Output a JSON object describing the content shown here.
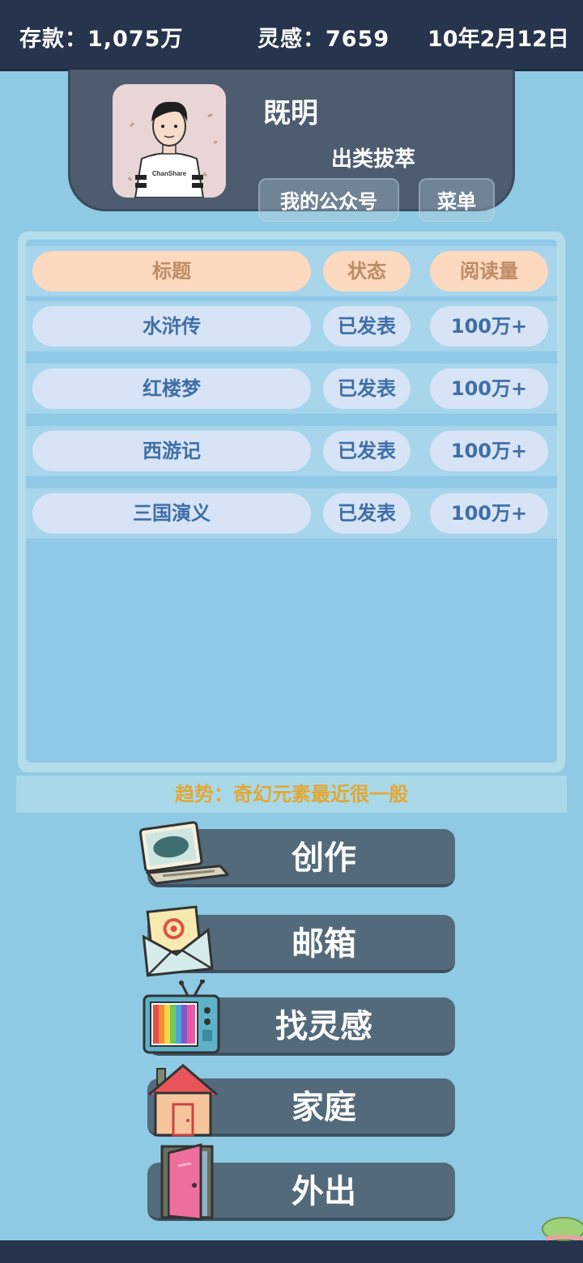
{
  "status_bar": {
    "money": "存款：1,075万",
    "inspiration": "灵感：7659",
    "date": "10年2月12日"
  },
  "profile": {
    "name": "既明",
    "title": "出类拔萃",
    "avatar_shirt_text": "ChanShare",
    "buttons": {
      "official_account": "我的公众号",
      "menu": "菜单"
    }
  },
  "table": {
    "headers": {
      "title": "标题",
      "status": "状态",
      "reads": "阅读量"
    },
    "rows": [
      {
        "title": "水浒传",
        "status": "已发表",
        "reads": "100万+"
      },
      {
        "title": "红楼梦",
        "status": "已发表",
        "reads": "100万+"
      },
      {
        "title": "西游记",
        "status": "已发表",
        "reads": "100万+"
      },
      {
        "title": "三国演义",
        "status": "已发表",
        "reads": "100万+"
      }
    ]
  },
  "trend": "趋势：奇幻元素最近很一般",
  "actions": [
    {
      "label": "创作",
      "icon": "laptop-icon"
    },
    {
      "label": "邮箱",
      "icon": "envelope-icon"
    },
    {
      "label": "找灵感",
      "icon": "tv-icon"
    },
    {
      "label": "家庭",
      "icon": "house-icon"
    },
    {
      "label": "外出",
      "icon": "door-icon"
    }
  ],
  "colors": {
    "background": "#8ecae3",
    "topbar": "#27344d",
    "profile_panel": "#4d5d6f",
    "header_pill": "#fcd9bf",
    "row_pill": "#d6e4f5",
    "row_text": "#3f6ea6",
    "trend_text": "#e2a734",
    "action_button": "#536a7b"
  }
}
